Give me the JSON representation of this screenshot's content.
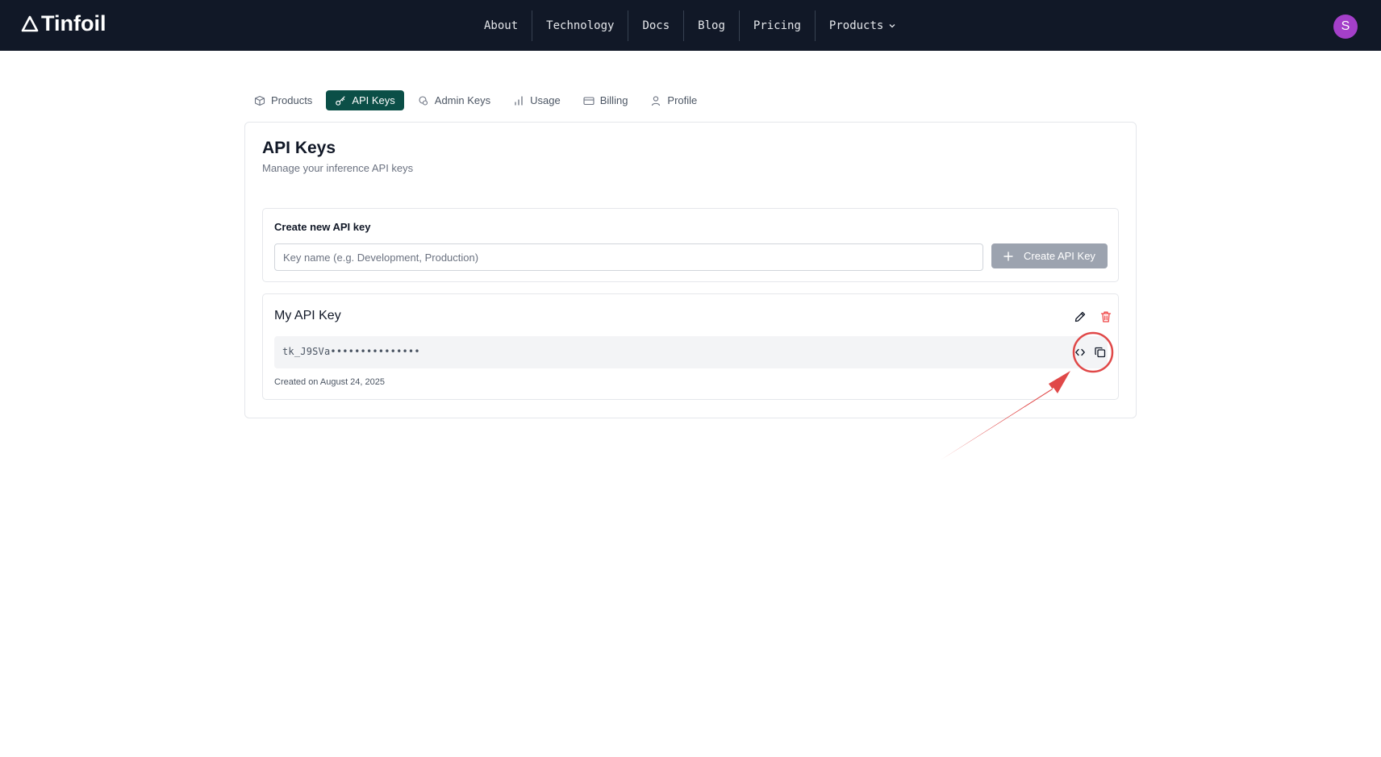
{
  "header": {
    "brand": "Tinfoil",
    "nav": [
      {
        "label": "About"
      },
      {
        "label": "Technology"
      },
      {
        "label": "Docs"
      },
      {
        "label": "Blog"
      },
      {
        "label": "Pricing"
      },
      {
        "label": "Products"
      }
    ],
    "avatar_initial": "S",
    "avatar_color": "#a43fc9"
  },
  "tabs": [
    {
      "label": "Products",
      "icon": "box-icon",
      "active": false
    },
    {
      "label": "API Keys",
      "icon": "key-icon",
      "active": true
    },
    {
      "label": "Admin Keys",
      "icon": "admin-key-icon",
      "active": false
    },
    {
      "label": "Usage",
      "icon": "bar-chart-icon",
      "active": false
    },
    {
      "label": "Billing",
      "icon": "credit-card-icon",
      "active": false
    },
    {
      "label": "Profile",
      "icon": "user-icon",
      "active": false
    }
  ],
  "page": {
    "title": "API Keys",
    "subtitle": "Manage your inference API keys"
  },
  "create": {
    "label": "Create new API key",
    "input_placeholder": "Key name (e.g. Development, Production)",
    "input_value": "",
    "button_label": "Create API Key"
  },
  "keys": [
    {
      "name": "My API Key",
      "masked_value": "tk_J9SVa•••••••••••••••",
      "created": "Created on August 24, 2025"
    }
  ],
  "colors": {
    "topbar": "#111827",
    "accent": "#0b4f47",
    "delete": "#ef4444",
    "annotation": "#e04848"
  }
}
